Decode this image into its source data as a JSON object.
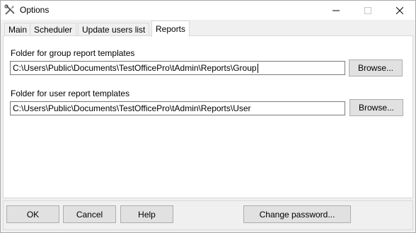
{
  "window": {
    "title": "Options",
    "app_icon": "tools-icon",
    "controls": [
      "minimize-icon",
      "maximize-icon",
      "close-icon"
    ]
  },
  "tabs": [
    {
      "label": "Main",
      "active": false
    },
    {
      "label": "Scheduler",
      "active": false
    },
    {
      "label": "Update users list",
      "active": false
    },
    {
      "label": "Reports",
      "active": true
    }
  ],
  "reports": {
    "group": {
      "label": "Folder for group report templates",
      "value": "C:\\Users\\Public\\Documents\\TestOfficePro\\tAdmin\\Reports\\Group",
      "browse_label": "Browse..."
    },
    "user": {
      "label": "Folder for user report templates",
      "value": "C:\\Users\\Public\\Documents\\TestOfficePro\\tAdmin\\Reports\\User",
      "browse_label": "Browse..."
    }
  },
  "footer": {
    "ok_label": "OK",
    "cancel_label": "Cancel",
    "help_label": "Help",
    "change_password_label": "Change password..."
  }
}
